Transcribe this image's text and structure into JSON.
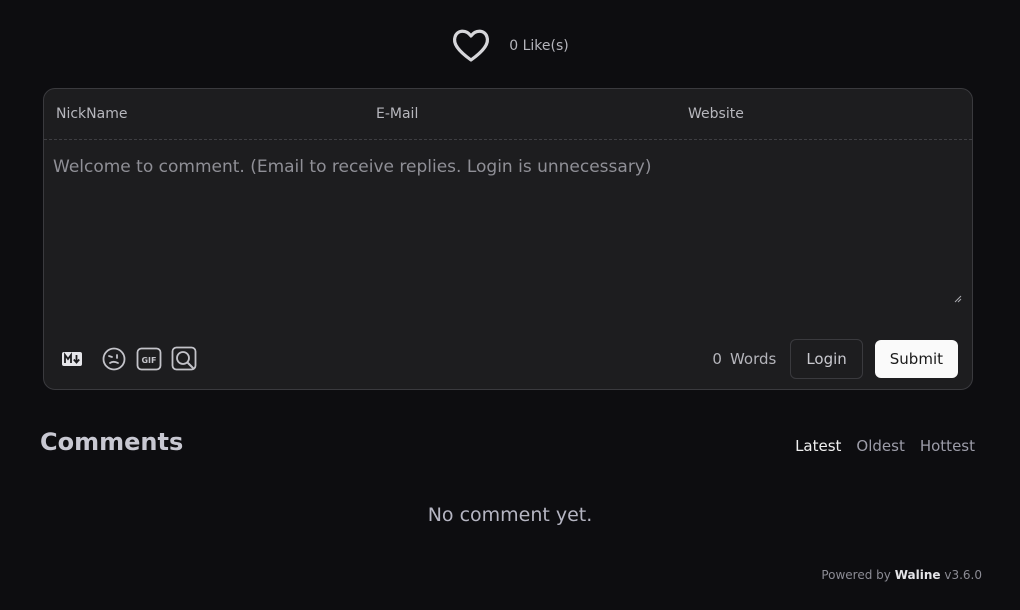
{
  "likes": {
    "count_text": "0 Like(s)"
  },
  "form": {
    "nick_placeholder": "NickName",
    "mail_placeholder": "E-Mail",
    "site_placeholder": "Website",
    "comment_placeholder": "Welcome to comment. (Email to receive replies. Login is unnecessary)"
  },
  "toolbar": {
    "icons": [
      "markdown-icon",
      "emoji-icon",
      "gif-icon",
      "preview-icon"
    ],
    "word_count": "0",
    "word_label": "Words",
    "login_label": "Login",
    "submit_label": "Submit"
  },
  "comments": {
    "title": "Comments",
    "sort": [
      "Latest",
      "Oldest",
      "Hottest"
    ],
    "active_sort": "Latest",
    "empty_text": "No comment yet."
  },
  "footer": {
    "powered_prefix": "Powered by",
    "brand": "Waline",
    "version": "v3.6.0"
  },
  "colors": {
    "background": "#0d0d10",
    "panel": "#1d1d1f",
    "submit_bg": "#fafafa"
  }
}
